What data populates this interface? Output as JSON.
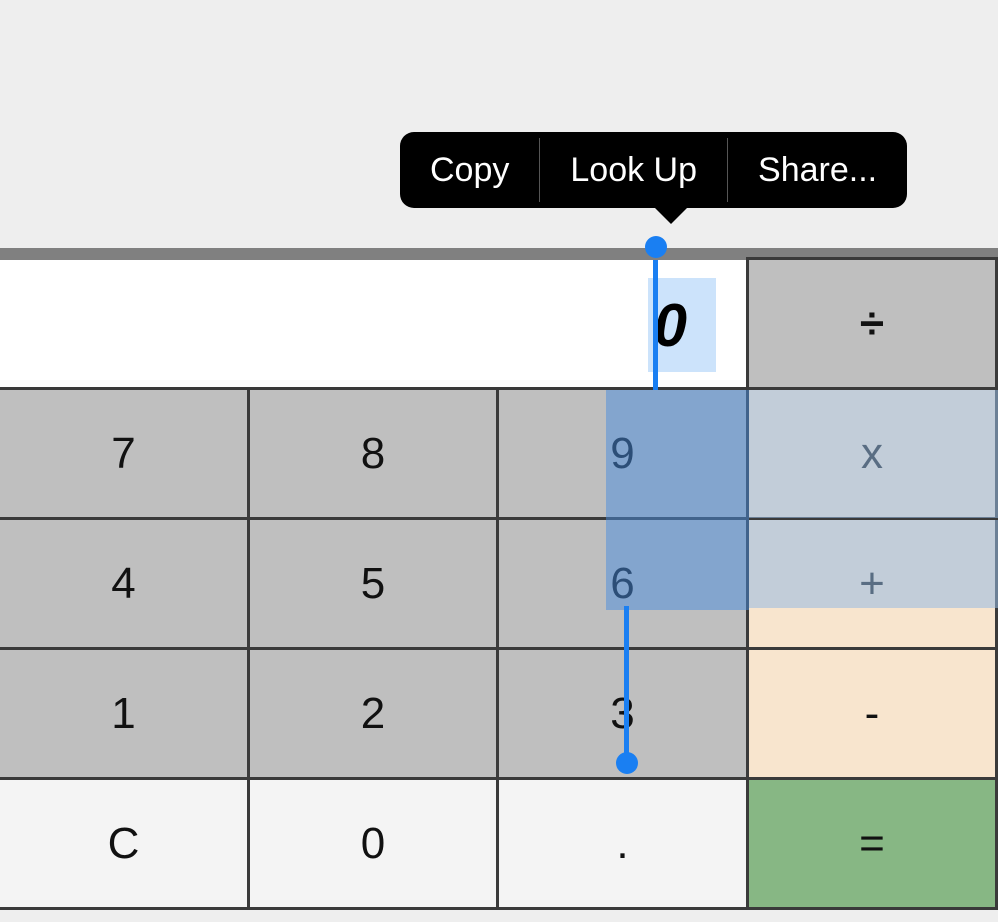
{
  "context_menu": {
    "copy": "Copy",
    "look_up": "Look Up",
    "share": "Share..."
  },
  "display": {
    "value": "0"
  },
  "ops": {
    "divide": "÷",
    "multiply": "x",
    "plus": "+",
    "minus": "-",
    "equals": "="
  },
  "keys": {
    "k7": "7",
    "k8": "8",
    "k9": "9",
    "k4": "4",
    "k5": "5",
    "k6": "6",
    "k1": "1",
    "k2": "2",
    "k3": "3",
    "clear": "C",
    "k0": "0",
    "dot": "."
  }
}
